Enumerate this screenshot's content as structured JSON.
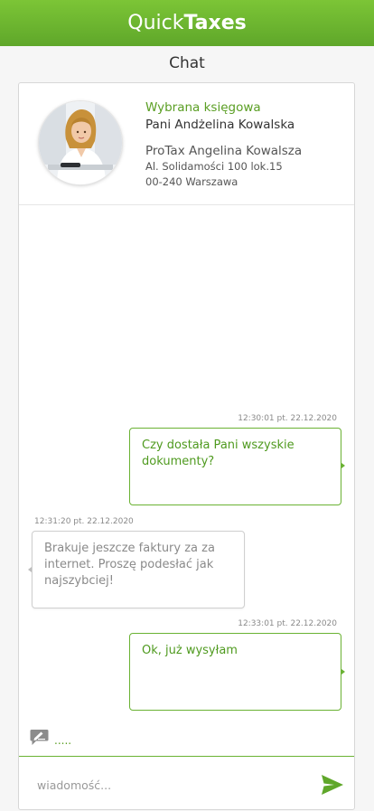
{
  "header": {
    "brand_light": "Quick",
    "brand_bold": "Taxes"
  },
  "page": {
    "title": "Chat"
  },
  "profile": {
    "role": "Wybrana księgowa",
    "name": "Pani Andżelina Kowalska",
    "company": "ProTax Angelina Kowalsza",
    "address_line1": "Al. Solidamości 100 lok.15",
    "address_line2": "00-240 Warszawa"
  },
  "messages": [
    {
      "direction": "out",
      "timestamp": "12:30:01 pt. 22.12.2020",
      "text": "Czy dostała Pani wszyskie dokumenty?"
    },
    {
      "direction": "in",
      "timestamp": "12:31:20 pt. 22.12.2020",
      "text": "Brakuje jeszcze faktury za za internet. Proszę podesłać jak najszybciej!"
    },
    {
      "direction": "out",
      "timestamp": "12:33:01 pt. 22.12.2020",
      "text": "Ok, już wysyłam"
    }
  ],
  "typing_indicator": {
    "text": "....."
  },
  "composer": {
    "placeholder": "wiadomość..."
  },
  "colors": {
    "brand_green": "#6ab233",
    "header_green": "#5fa72a",
    "incoming_text": "#8a8a8a"
  }
}
